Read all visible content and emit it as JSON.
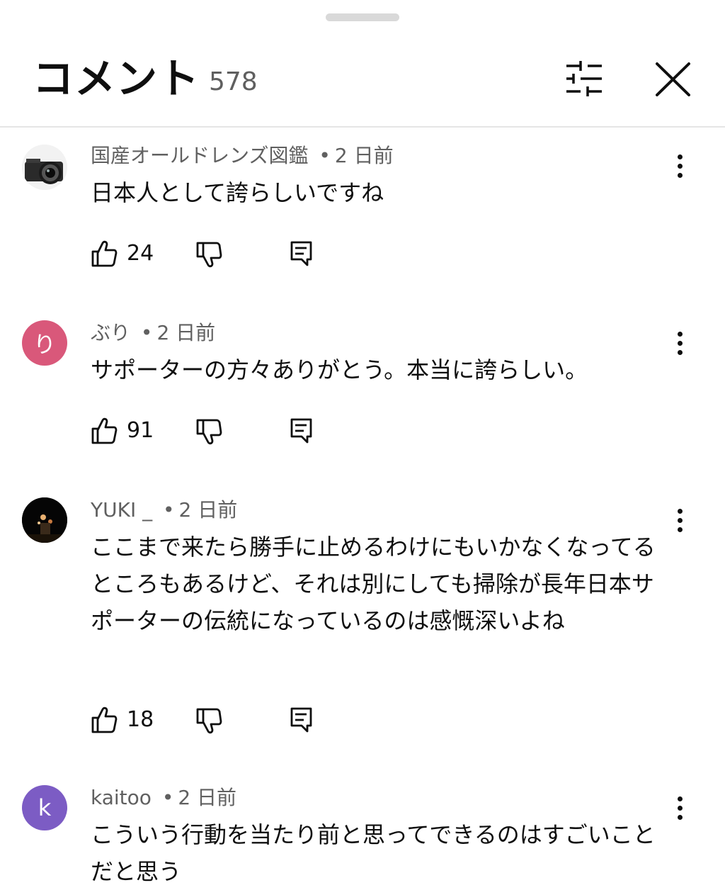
{
  "header": {
    "title": "コメント",
    "count": "578"
  },
  "comments": [
    {
      "author": "国産オールドレンズ図鑑",
      "time": "2 日前",
      "text": "日本人として誇らしいですね",
      "likes": "24",
      "avatar_type": "camera-photo"
    },
    {
      "author": "ぶり",
      "time": "2 日前",
      "text": "サポーターの方々ありがとう。本当に誇らしい。",
      "likes": "91",
      "avatar_letter": "り",
      "avatar_color": "#d9587a"
    },
    {
      "author": "YUKI _",
      "time": "2 日前",
      "text": "ここまで来たら勝手に止めるわけにもいかなくなってるところもあるけど、それは別にしても掃除が長年日本サポーターの伝統になっているのは感慨深いよね",
      "likes": "18",
      "avatar_type": "night-photo"
    },
    {
      "author": "kaitoo",
      "time": "2 日前",
      "text": "こういう行動を当たり前と思ってできるのはすごいことだと思う",
      "avatar_letter": "k",
      "avatar_color": "#7c5cc4"
    }
  ],
  "meta_separator": "•",
  "colors": {
    "text_primary": "#0f0f0f",
    "text_secondary": "#606060",
    "divider": "#e5e5e5"
  },
  "icons": [
    "filter-icon",
    "close-icon",
    "more-vert-icon",
    "thumbs-up-icon",
    "thumbs-down-icon",
    "reply-icon"
  ]
}
